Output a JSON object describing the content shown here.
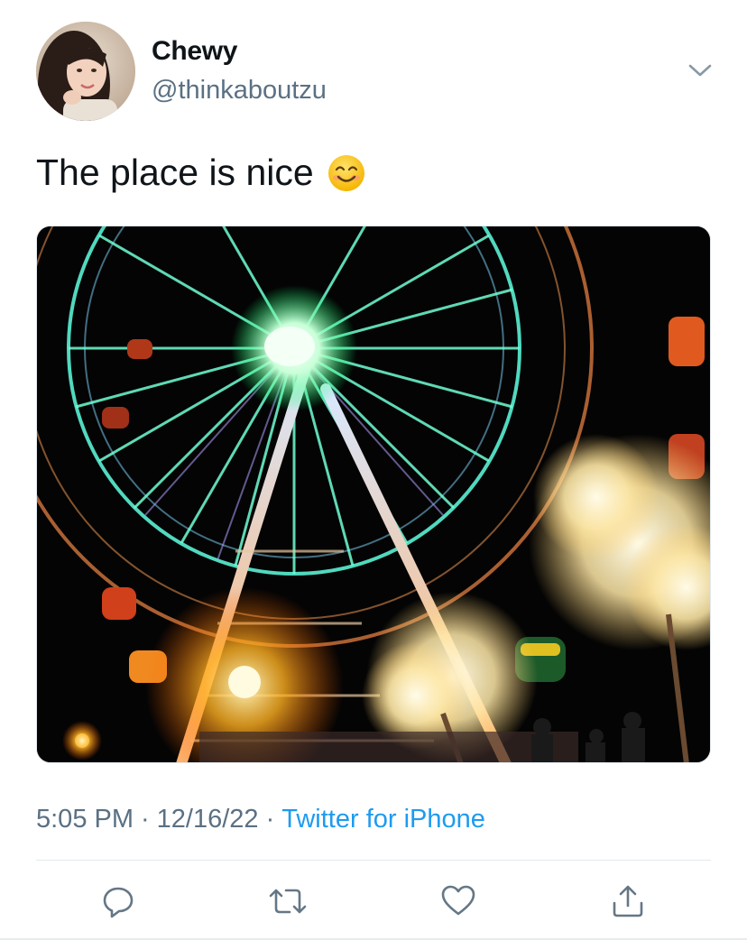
{
  "author": {
    "display_name": "Chewy",
    "handle": "@thinkaboutzu"
  },
  "tweet": {
    "text": "The place is nice",
    "emoji_icon": "smiling-face-icon",
    "media_description_icon": "ferris-wheel-photo"
  },
  "meta": {
    "time": "5:05 PM",
    "date": "12/16/22",
    "separator": "·",
    "source": "Twitter for iPhone"
  },
  "actions": [
    {
      "icon": "reply-icon"
    },
    {
      "icon": "retweet-icon"
    },
    {
      "icon": "like-icon"
    },
    {
      "icon": "share-icon"
    }
  ],
  "colors": {
    "text_primary": "#0f1419",
    "text_secondary": "#5b7083",
    "link": "#1d9bf0",
    "divider": "#e1e8ed"
  }
}
